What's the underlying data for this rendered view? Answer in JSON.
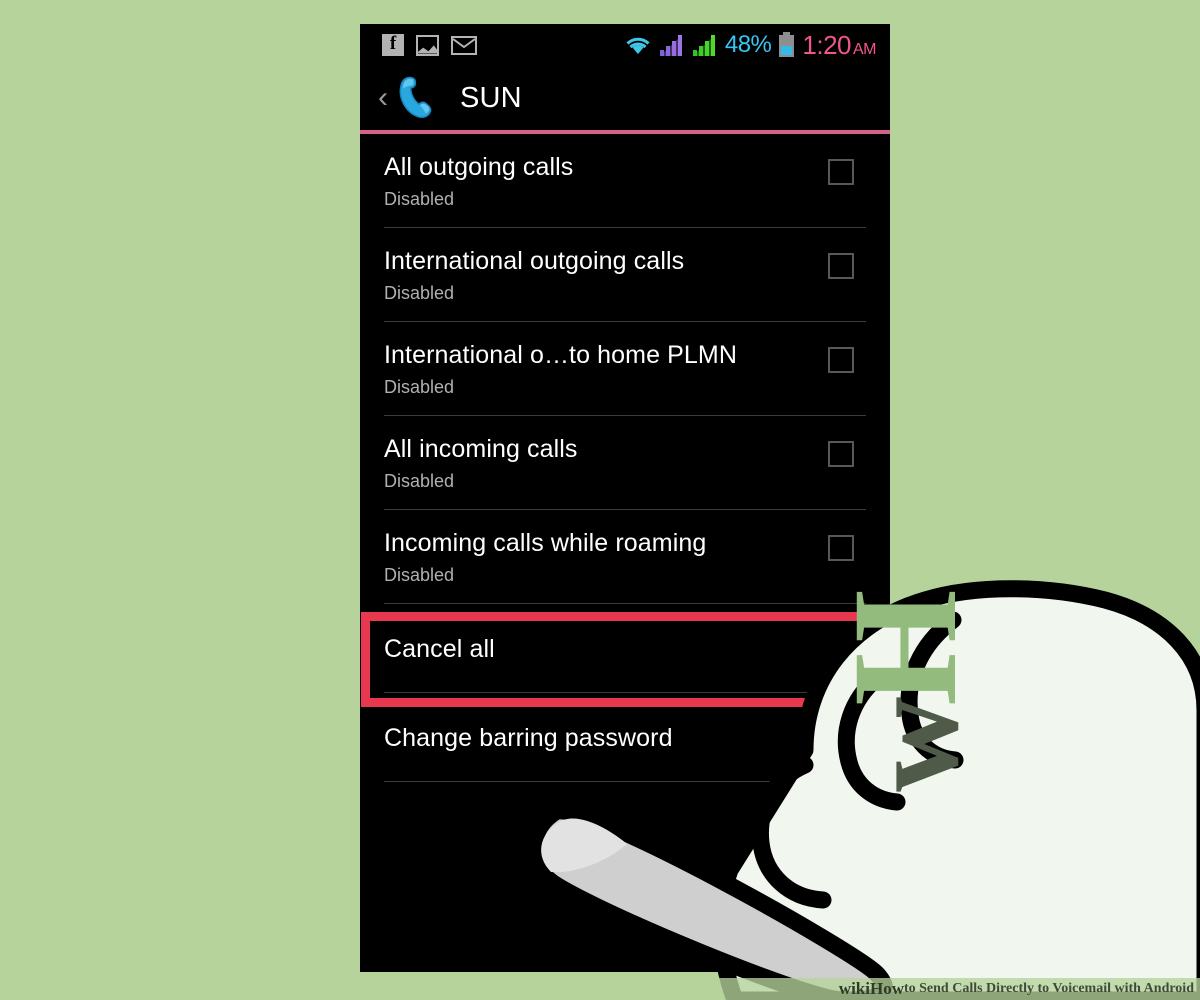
{
  "background_color": "#b5d39b",
  "accent_colors": {
    "header_rule": "#d4608c",
    "highlight_box": "#e8384f",
    "clock": "#f0568c",
    "battery_text": "#35c6f4",
    "phone_icon": "#29a8e0"
  },
  "status_bar": {
    "left_icons": [
      {
        "name": "facebook-icon",
        "glyph": "f"
      },
      {
        "name": "gallery-icon",
        "glyph": ""
      },
      {
        "name": "email-icon",
        "glyph": ""
      }
    ],
    "wifi_icon": "wifi-icon",
    "signal_1_icon": "signal-bars-icon",
    "signal_2_icon": "signal-bars-icon",
    "battery_percent": "48%",
    "battery_icon": "battery-icon",
    "time": "1:20",
    "ampm": "AM"
  },
  "header": {
    "back_icon": "‹",
    "app_icon": "phone-handset-icon",
    "title": "SUN"
  },
  "settings": {
    "rows": [
      {
        "title": "All outgoing calls",
        "subtitle": "Disabled",
        "checked": false
      },
      {
        "title": "International outgoing calls",
        "subtitle": "Disabled",
        "checked": false
      },
      {
        "title": "International o…to home PLMN",
        "subtitle": "Disabled",
        "checked": false
      },
      {
        "title": "All incoming calls",
        "subtitle": "Disabled",
        "checked": false
      },
      {
        "title": "Incoming calls while roaming",
        "subtitle": "Disabled",
        "checked": false
      }
    ],
    "actions": [
      {
        "title": "Cancel all"
      },
      {
        "title": "Change barring password"
      }
    ]
  },
  "annotation": {
    "highlight_target": "Cancel all",
    "hand_cursor": "pointing-hand-cursor",
    "watermark": "wH"
  },
  "footer": {
    "brand": "wikiHow",
    "caption": " to Send Calls Directly to Voicemail with Android"
  }
}
